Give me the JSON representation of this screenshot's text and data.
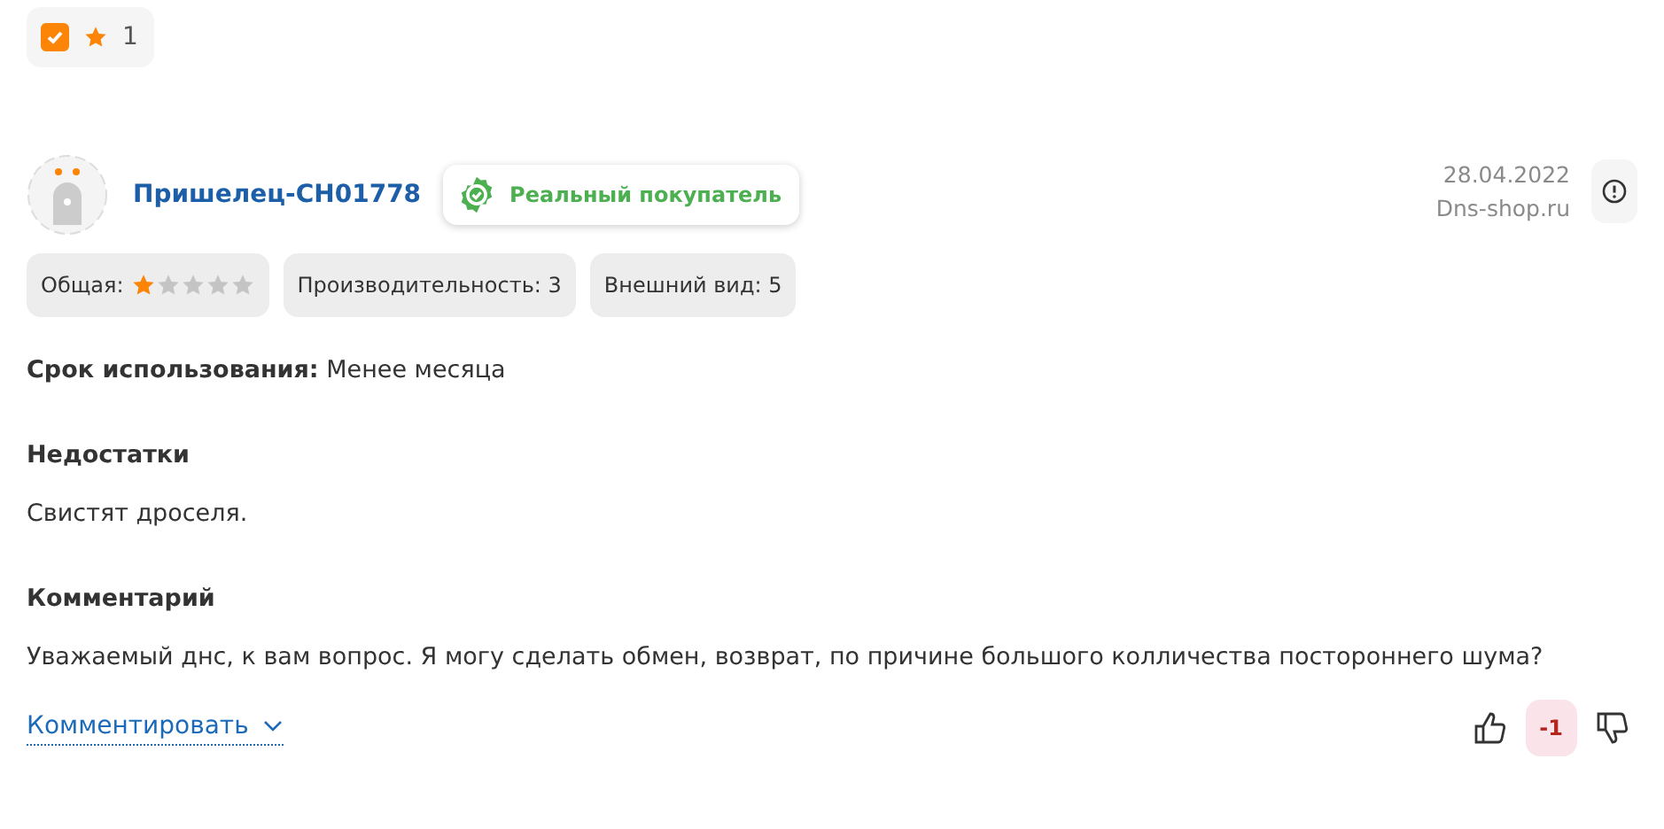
{
  "filter_chip": {
    "checked": true,
    "label": "1"
  },
  "review": {
    "author": "Пришелец-CH01778",
    "badge": "Реальный покупатель",
    "date": "28.04.2022",
    "source": "Dns-shop.ru",
    "ratings": [
      {
        "kind": "stars",
        "label": "Общая:",
        "stars": 1
      },
      {
        "kind": "text",
        "label": "Производительность: 3"
      },
      {
        "kind": "text",
        "label": "Внешний вид: 5"
      }
    ],
    "usage": {
      "label": "Срок использования:",
      "value": "Менее месяца"
    },
    "sections": [
      {
        "title": "Недостатки",
        "text": "Свистят дроселя."
      },
      {
        "title": "Комментарий",
        "text": "Уважаемый днс, к вам вопрос. Я могу сделать обмен, возврат, по причине большого колличества постороннего шума?"
      }
    ],
    "comment_link": "Комментировать",
    "score": "-1"
  }
}
